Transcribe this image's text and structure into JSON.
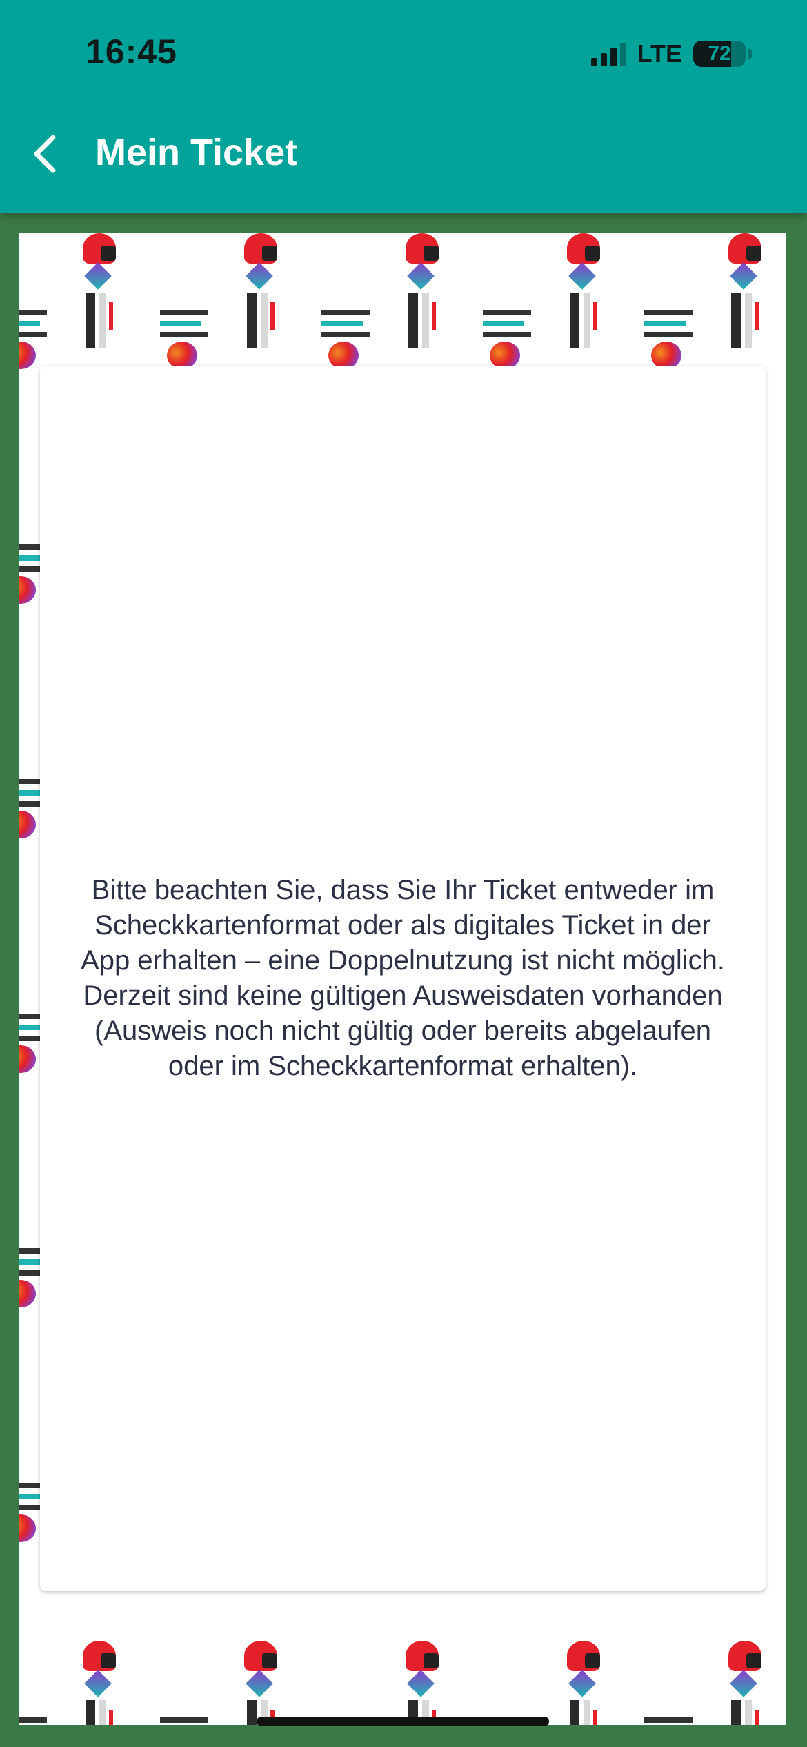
{
  "status_bar": {
    "time": "16:45",
    "network": "LTE",
    "battery": "72",
    "battery_level": 0.72
  },
  "header": {
    "title": "Mein Ticket",
    "back_icon": "chevron-left-icon",
    "background_color": "#00a39a"
  },
  "card": {
    "message": "Bitte beachten Sie, dass Sie Ihr Ticket entweder im Scheckkartenformat oder als digitales Ticket in der App erhalten – eine Doppelnutzung ist nicht möglich. Derzeit sind keine gültigen Ausweisdaten vorhanden (Ausweis noch nicht gültig oder bereits abgelaufen oder im Scheckkartenformat erhalten)."
  },
  "colors": {
    "accent": "#00a39a",
    "frame": "#3a7a46",
    "text": "#2c3045"
  }
}
